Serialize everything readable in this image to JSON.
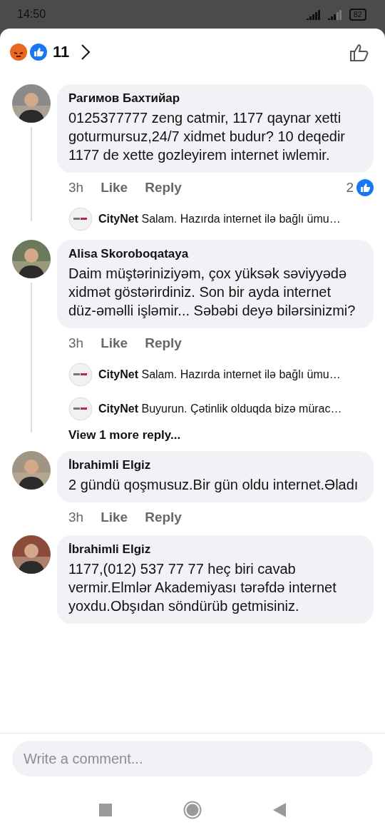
{
  "status_bar": {
    "time": "14:50",
    "battery": "82"
  },
  "header": {
    "reaction_count": "11"
  },
  "comments": [
    {
      "author": "Рагимов Бахтийар",
      "text": "0125377777 zeng catmir, 1177 qaynar xetti goturmursuz,24/7 xidmet budur? 10 deqedir 1177 de xette gozleyirem internet iwlemir.",
      "time": "3h",
      "like": "Like",
      "reply": "Reply",
      "likes": "2",
      "replies": [
        {
          "author": "CityNet",
          "text": "Salam. Hazırda internet ilə bağlı ümu…"
        }
      ]
    },
    {
      "author": "Alisa Skoroboqataya",
      "text": "Daim müştəriniziyəm, çox yüksək səviyyədə xidmət göstərirdiniz. Son bir ayda internet düz-əməlli işləmir... Səbəbi deyə bilərsinizmi?",
      "time": "3h",
      "like": "Like",
      "reply": "Reply",
      "replies": [
        {
          "author": "CityNet",
          "text": "Salam. Hazırda internet ilə bağlı ümu…"
        },
        {
          "author": "CityNet",
          "text": "Buyurun. Çətinlik olduqda bizə mürac…"
        }
      ],
      "more_replies": "View 1 more reply..."
    },
    {
      "author": "İbrahimli Elgiz",
      "text": "2 gündü qoşmusuz.Bir gün oldu internet.Əladı",
      "time": "3h",
      "like": "Like",
      "reply": "Reply"
    },
    {
      "author": "İbrahimli Elgiz",
      "text": "1177,(012) 537 77 77 heç biri cavab vermir.Elmlər Akademiyası tərəfdə internet yoxdu.Obşıdan söndürüb getmisiniz."
    }
  ],
  "composer": {
    "placeholder": "Write a comment..."
  }
}
